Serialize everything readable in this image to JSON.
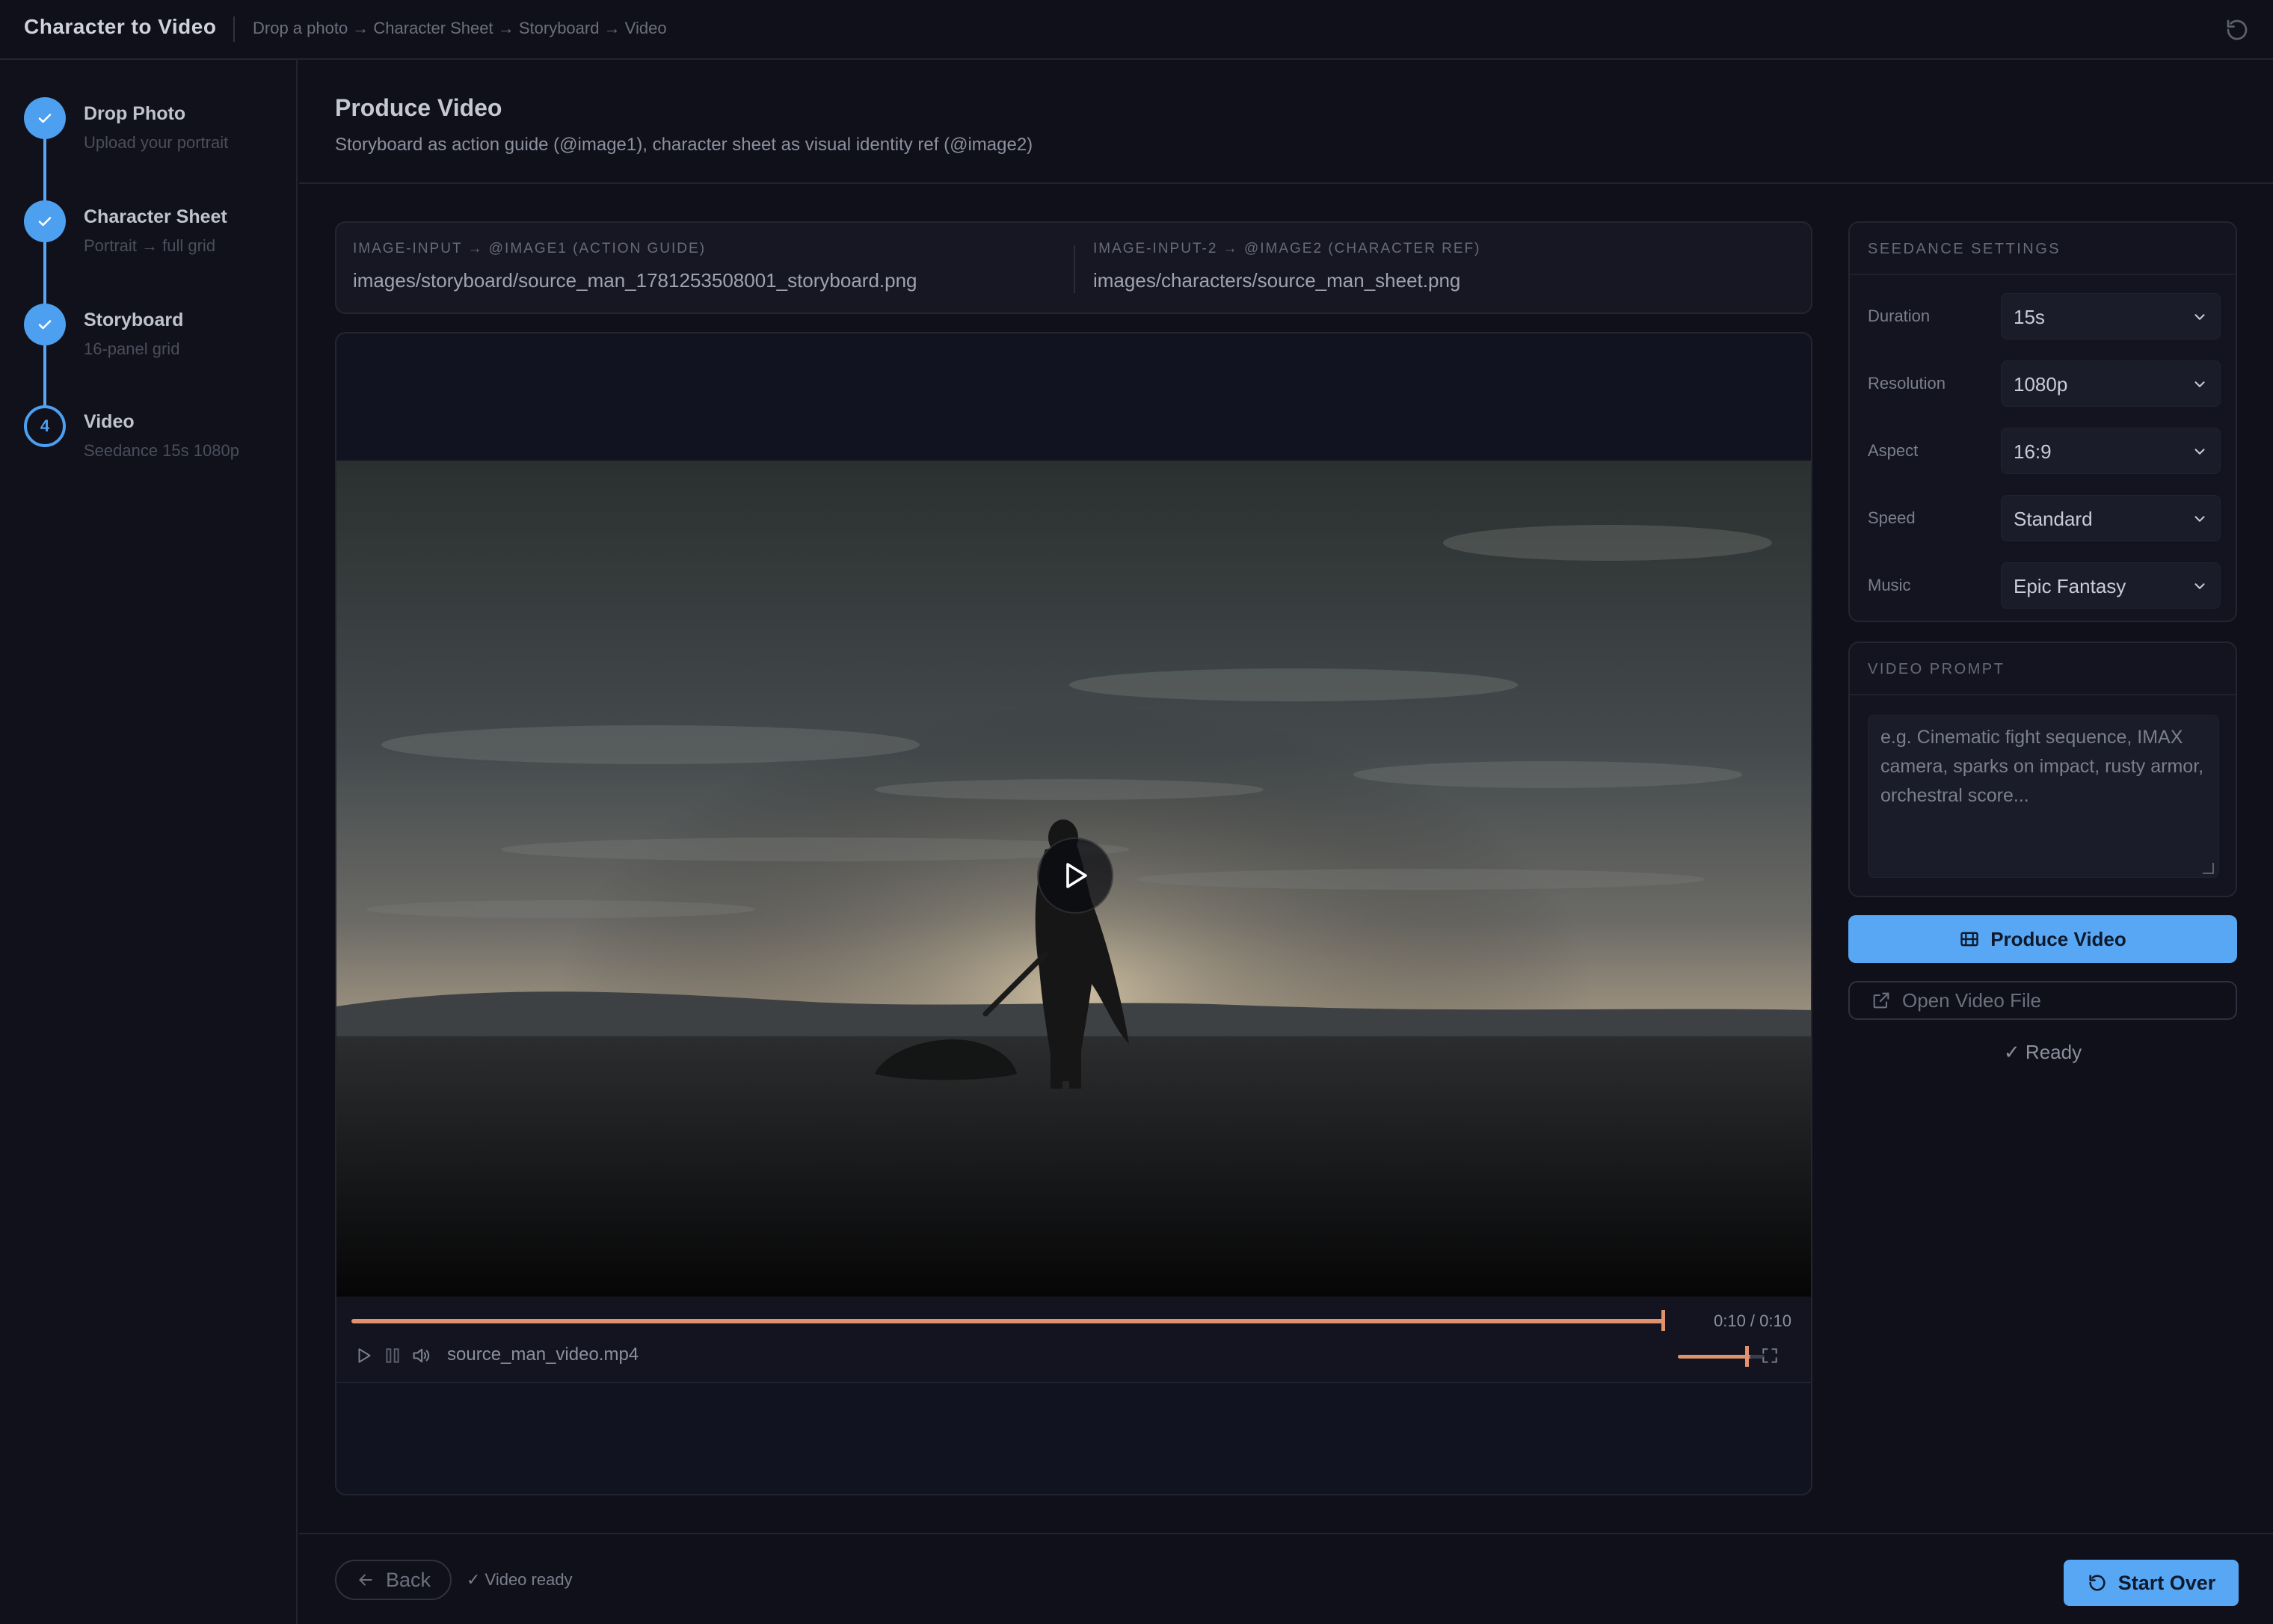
{
  "app": {
    "title": "Character to Video",
    "breadcrumb": "Drop a photo → Character Sheet → Storyboard → Video"
  },
  "steps": [
    {
      "title": "Drop Photo",
      "subtitle": "Upload your portrait",
      "state": "done"
    },
    {
      "title": "Character Sheet",
      "subtitle": "Portrait → full grid",
      "state": "done"
    },
    {
      "title": "Storyboard",
      "subtitle": "16-panel grid",
      "state": "done"
    },
    {
      "title": "Video",
      "subtitle": "Seedance 15s 1080p",
      "state": "current",
      "number": "4"
    }
  ],
  "page": {
    "title": "Produce Video",
    "subtitle": "Storyboard as action guide (@image1), character sheet as visual identity ref (@image2)"
  },
  "inputs": [
    {
      "label": "IMAGE-INPUT → @IMAGE1 (ACTION GUIDE)",
      "value": "images/storyboard/source_man_1781253508001_storyboard.png"
    },
    {
      "label": "IMAGE-INPUT-2 → @IMAGE2 (CHARACTER REF)",
      "value": "images/characters/source_man_sheet.png"
    }
  ],
  "player": {
    "file_name": "source_man_video.mp4",
    "time": "0:10 / 0:10",
    "progress": 1.0,
    "volume": 0.8
  },
  "settings": {
    "header": "SEEDANCE SETTINGS",
    "rows": [
      {
        "label": "Duration",
        "value": "15s"
      },
      {
        "label": "Resolution",
        "value": "1080p"
      },
      {
        "label": "Aspect",
        "value": "16:9"
      },
      {
        "label": "Speed",
        "value": "Standard"
      },
      {
        "label": "Music",
        "value": "Epic Fantasy"
      }
    ]
  },
  "prompt": {
    "header": "VIDEO PROMPT",
    "placeholder": "e.g. Cinematic fight sequence, IMAX camera, sparks on impact, rusty armor, orchestral score...",
    "value": ""
  },
  "actions": {
    "produce_label": "Produce Video",
    "open_label": "Open Video File",
    "status": "✓ Ready"
  },
  "footer": {
    "back_label": "Back",
    "status": "✓ Video ready",
    "start_over_label": "Start Over"
  },
  "colors": {
    "accent": "#58a7f5",
    "progress": "#e0916d",
    "background": "#0f1019"
  },
  "icons": {
    "reset": "reset-icon",
    "check": "check-icon",
    "play": "play-icon",
    "pause": "pause-icon",
    "volume": "volume-icon",
    "fullscreen": "fullscreen-icon",
    "chevron": "chevron-down-icon",
    "film": "film-icon",
    "external": "external-link-icon",
    "back": "arrow-left-icon"
  }
}
